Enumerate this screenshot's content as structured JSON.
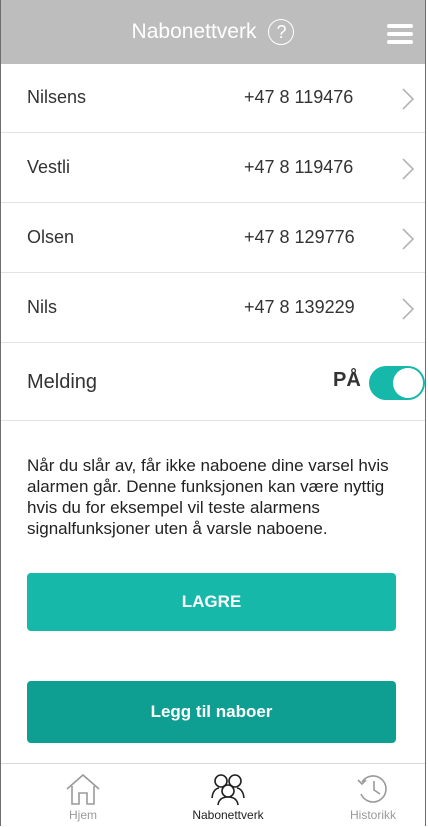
{
  "header": {
    "title": "Nabonettverk",
    "help_symbol": "?"
  },
  "contacts": [
    {
      "name": "Nilsens",
      "phone": "+47 8 119476"
    },
    {
      "name": "Vestli",
      "phone": "+47 8 119476"
    },
    {
      "name": "Olsen",
      "phone": "+47 8 129776"
    },
    {
      "name": "Nils",
      "phone": "+47 8 139229"
    }
  ],
  "message": {
    "label": "Melding",
    "state": "PÅ",
    "enabled": true
  },
  "info_text": "Når du slår av, får ikke naboene dine varsel hvis alarmen går. Denne funksjonen kan være nyttig hvis du for eksempel vil teste alarmens signalfunksjoner uten å varsle naboene.",
  "buttons": {
    "save": "LAGRE",
    "add_neighbors": "Legg til naboer"
  },
  "tabs": [
    {
      "label": "Hjem",
      "icon": "home-icon",
      "active": false
    },
    {
      "label": "Nabonettverk",
      "icon": "people-icon",
      "active": true
    },
    {
      "label": "Historikk",
      "icon": "history-icon",
      "active": false
    }
  ],
  "colors": {
    "header": "#bdbdbd",
    "accent": "#16b8a9",
    "accent_dark": "#0f9f92"
  }
}
